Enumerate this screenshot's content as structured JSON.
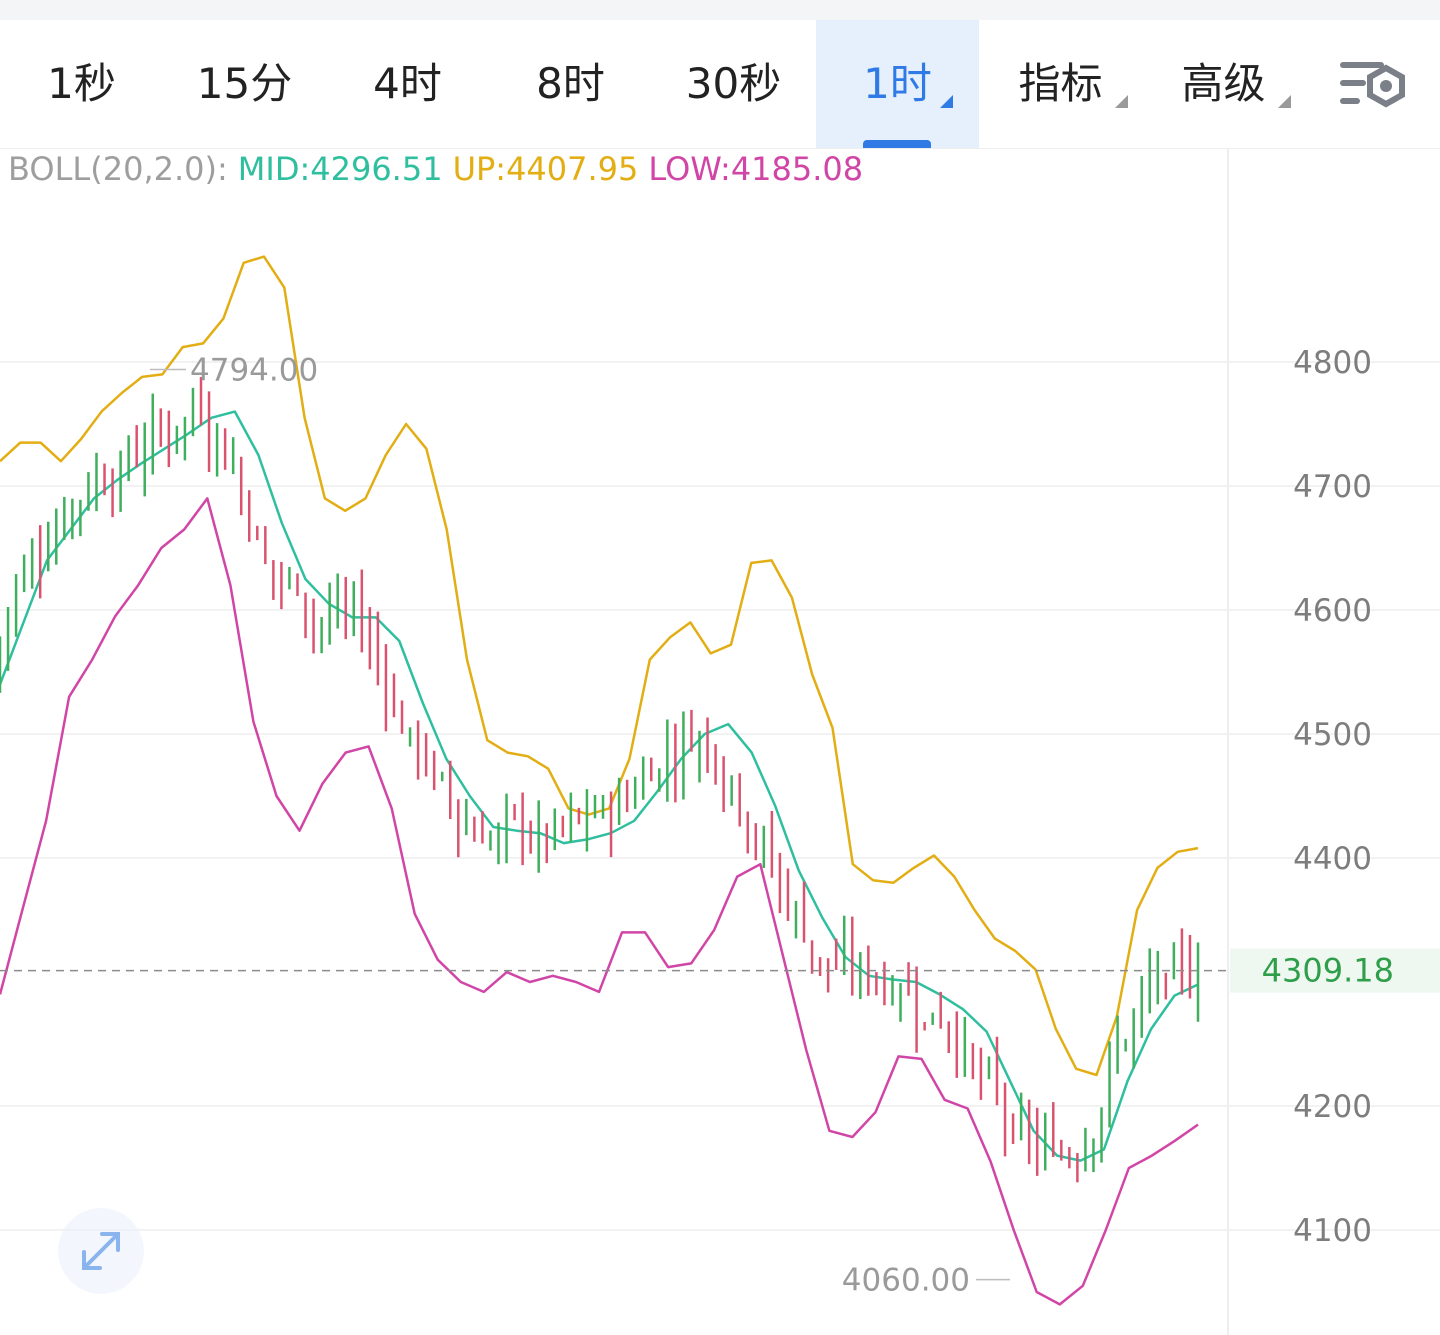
{
  "tabs": [
    {
      "label": "1秒",
      "active": false,
      "dropdown": false
    },
    {
      "label": "15分",
      "active": false,
      "dropdown": false
    },
    {
      "label": "4时",
      "active": false,
      "dropdown": false
    },
    {
      "label": "8时",
      "active": false,
      "dropdown": false
    },
    {
      "label": "30秒",
      "active": false,
      "dropdown": false
    },
    {
      "label": "1时",
      "active": true,
      "dropdown": true
    },
    {
      "label": "指标",
      "active": false,
      "dropdown": true
    },
    {
      "label": "高级",
      "active": false,
      "dropdown": true
    }
  ],
  "icons": {
    "settings": "chart-settings-icon",
    "expand": "expand-icon"
  },
  "legend": {
    "name": "BOLL(20,2.0):",
    "mid": "MID:4296.51",
    "up": "UP:4407.95",
    "low": "LOW:4185.08"
  },
  "colors": {
    "up_candle": "#3fae5d",
    "down_candle": "#d9536f",
    "mid": "#2fbf9f",
    "upper": "#e2ae14",
    "lower": "#d145a6",
    "accent": "#2f7ae5",
    "price_label": "#2f9e4a"
  },
  "chart_data": {
    "type": "candlestick",
    "indicator": "BOLL(20,2.0)",
    "y_axis": {
      "ticks": [
        4800,
        4700,
        4600,
        4500,
        4400,
        4200,
        4100
      ],
      "range": [
        4040,
        4960
      ]
    },
    "current_price": 4309.18,
    "current_price_label": "4309.18",
    "high_marker": {
      "value": 4794.0,
      "label": "4794.00"
    },
    "low_marker": {
      "value": 4060.0,
      "label": "4060.00"
    },
    "upper": [
      4720,
      4735,
      4735,
      4720,
      4738,
      4760,
      4775,
      4788,
      4790,
      4812,
      4815,
      4835,
      4880,
      4885,
      4860,
      4755,
      4690,
      4680,
      4690,
      4725,
      4750,
      4730,
      4665,
      4560,
      4495,
      4485,
      4482,
      4472,
      4440,
      4435,
      4440,
      4480,
      4560,
      4578,
      4590,
      4565,
      4572,
      4638,
      4640,
      4610,
      4548,
      4505,
      4395,
      4382,
      4380,
      4392,
      4402,
      4385,
      4358,
      4335,
      4325,
      4310,
      4262,
      4230,
      4225,
      4272,
      4358,
      4392,
      4405,
      4408
    ],
    "mid": [
      4540,
      4590,
      4640,
      4665,
      4690,
      4705,
      4718,
      4730,
      4742,
      4755,
      4760,
      4725,
      4670,
      4625,
      4605,
      4594,
      4594,
      4575,
      4525,
      4480,
      4450,
      4425,
      4422,
      4420,
      4412,
      4415,
      4420,
      4430,
      4454,
      4480,
      4500,
      4508,
      4485,
      4442,
      4390,
      4352,
      4320,
      4305,
      4302,
      4300,
      4290,
      4278,
      4260,
      4220,
      4180,
      4160,
      4156,
      4165,
      4220,
      4262,
      4289,
      4298
    ],
    "lower": [
      4290,
      4360,
      4430,
      4530,
      4560,
      4595,
      4620,
      4650,
      4665,
      4690,
      4620,
      4510,
      4450,
      4422,
      4460,
      4485,
      4490,
      4440,
      4355,
      4318,
      4300,
      4292,
      4308,
      4300,
      4305,
      4300,
      4292,
      4340,
      4340,
      4312,
      4315,
      4342,
      4385,
      4395,
      4320,
      4245,
      4180,
      4175,
      4195,
      4240,
      4238,
      4205,
      4198,
      4155,
      4100,
      4050,
      4040,
      4055,
      4100,
      4150,
      4160,
      4172,
      4185
    ]
  }
}
